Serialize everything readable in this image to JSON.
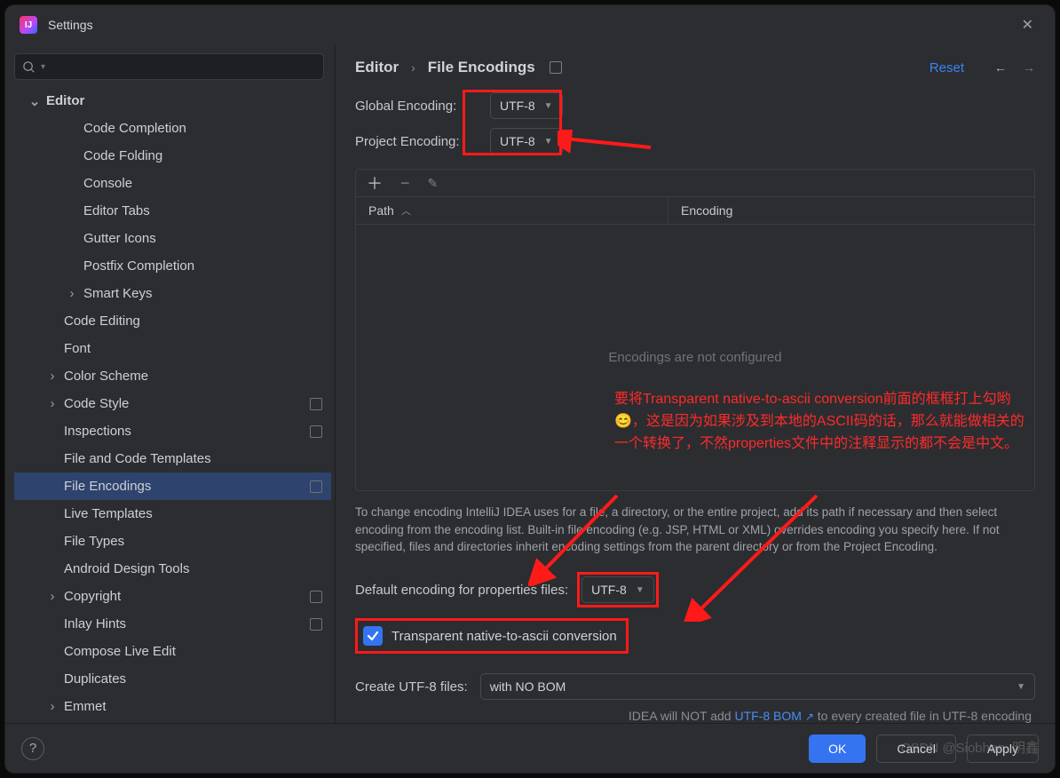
{
  "window": {
    "title": "Settings"
  },
  "search": {
    "placeholder": ""
  },
  "sidebar": {
    "items": [
      {
        "label": "Editor",
        "indent": 0,
        "bold": true,
        "chev": "down"
      },
      {
        "label": "Code Completion",
        "indent": 2
      },
      {
        "label": "Code Folding",
        "indent": 2
      },
      {
        "label": "Console",
        "indent": 2
      },
      {
        "label": "Editor Tabs",
        "indent": 2
      },
      {
        "label": "Gutter Icons",
        "indent": 2
      },
      {
        "label": "Postfix Completion",
        "indent": 2
      },
      {
        "label": "Smart Keys",
        "indent": 2,
        "chev": "right"
      },
      {
        "label": "Code Editing",
        "indent": 1
      },
      {
        "label": "Font",
        "indent": 1
      },
      {
        "label": "Color Scheme",
        "indent": 1,
        "chev": "right"
      },
      {
        "label": "Code Style",
        "indent": 1,
        "chev": "right",
        "endIcon": true
      },
      {
        "label": "Inspections",
        "indent": 1,
        "endIcon": true
      },
      {
        "label": "File and Code Templates",
        "indent": 1
      },
      {
        "label": "File Encodings",
        "indent": 1,
        "selected": true,
        "endIcon": true
      },
      {
        "label": "Live Templates",
        "indent": 1
      },
      {
        "label": "File Types",
        "indent": 1
      },
      {
        "label": "Android Design Tools",
        "indent": 1
      },
      {
        "label": "Copyright",
        "indent": 1,
        "chev": "right",
        "endIcon": true
      },
      {
        "label": "Inlay Hints",
        "indent": 1,
        "endIcon": true
      },
      {
        "label": "Compose Live Edit",
        "indent": 1
      },
      {
        "label": "Duplicates",
        "indent": 1
      },
      {
        "label": "Emmet",
        "indent": 1,
        "chev": "right"
      }
    ]
  },
  "breadcrumb": {
    "root": "Editor",
    "leaf": "File Encodings"
  },
  "reset_label": "Reset",
  "encoding": {
    "global_label": "Global Encoding:",
    "global_value": "UTF-8",
    "project_label": "Project Encoding:",
    "project_value": "UTF-8"
  },
  "table": {
    "col_path": "Path",
    "col_encoding": "Encoding",
    "empty": "Encodings are not configured"
  },
  "help_text": "To change encoding IntelliJ IDEA uses for a file, a directory, or the entire project, add its path if necessary and then select encoding from the encoding list. Built-in file encoding (e.g. JSP, HTML or XML) overrides encoding you specify here. If not specified, files and directories inherit encoding settings from the parent directory or from the Project Encoding.",
  "properties": {
    "label": "Default encoding for properties files:",
    "value": "UTF-8",
    "checkbox_label": "Transparent native-to-ascii conversion",
    "checked": true
  },
  "utf8": {
    "label": "Create UTF-8 files:",
    "value": "with NO BOM",
    "note_prefix": "IDEA will NOT add ",
    "note_link": "UTF-8 BOM",
    "note_suffix": " to every created file in UTF-8 encoding"
  },
  "buttons": {
    "ok": "OK",
    "cancel": "Cancel",
    "apply": "Apply"
  },
  "annotation": "要将Transparent native-to-ascii conversion前面的框框打上勾哟😊，这是因为如果涉及到本地的ASCII码的话，那么就能做相关的一个转换了，不然properties文件中的注释显示的都不会是中文。",
  "watermark": "CSDN @Siobhan. 明鑫"
}
